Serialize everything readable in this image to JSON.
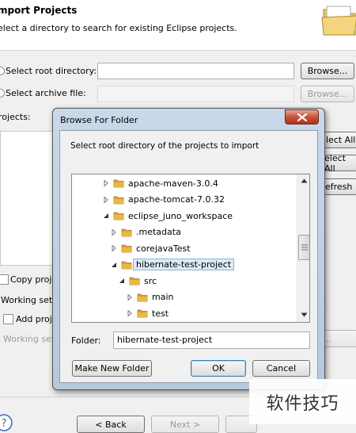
{
  "wizard": {
    "title": "mport Projects",
    "description": "elect a directory to search for existing Eclipse projects.",
    "root_dir_label": "Select root directory:",
    "archive_label": "Select archive file:",
    "browse_label": "Browse...",
    "browse2_label": "Browse...",
    "projects_label": "rojects:",
    "select_all_label": "lect All",
    "deselect_all_label": "elect All",
    "refresh_label": "efresh",
    "copy_projects_label": "Copy proje",
    "working_sets_label": "Working sets",
    "add_project_label": "Add proje",
    "working_sets_field_label": "Working set",
    "working_sets_select_label": "ct...",
    "back_label": "< Back",
    "next_label": "Next >"
  },
  "dialog": {
    "title": "Browse For Folder",
    "instruction": "Select root directory of the projects to import",
    "tree": [
      {
        "label": "apache-maven-3.0.4",
        "depth": 0,
        "toggle": "collapsed",
        "selected": false
      },
      {
        "label": "apache-tomcat-7.0.32",
        "depth": 0,
        "toggle": "collapsed",
        "selected": false
      },
      {
        "label": "eclipse_juno_workspace",
        "depth": 0,
        "toggle": "expanded",
        "selected": false
      },
      {
        "label": ".metadata",
        "depth": 1,
        "toggle": "collapsed",
        "selected": false
      },
      {
        "label": "corejavaTest",
        "depth": 1,
        "toggle": "collapsed",
        "selected": false
      },
      {
        "label": "hibernate-test-project",
        "depth": 1,
        "toggle": "expanded",
        "selected": true
      },
      {
        "label": "src",
        "depth": 2,
        "toggle": "expanded",
        "selected": false
      },
      {
        "label": "main",
        "depth": 3,
        "toggle": "collapsed",
        "selected": false
      },
      {
        "label": "test",
        "depth": 3,
        "toggle": "collapsed",
        "selected": false
      }
    ],
    "folder_label": "Folder:",
    "folder_value": "hibernate-test-project",
    "make_new_folder_label": "Make New Folder",
    "ok_label": "OK",
    "cancel_label": "Cancel"
  },
  "watermark": {
    "text": "软件技巧"
  },
  "colors": {
    "folder": "#e8b843",
    "selection_bg": "#dde9f7",
    "close_button": "#c7543c"
  }
}
